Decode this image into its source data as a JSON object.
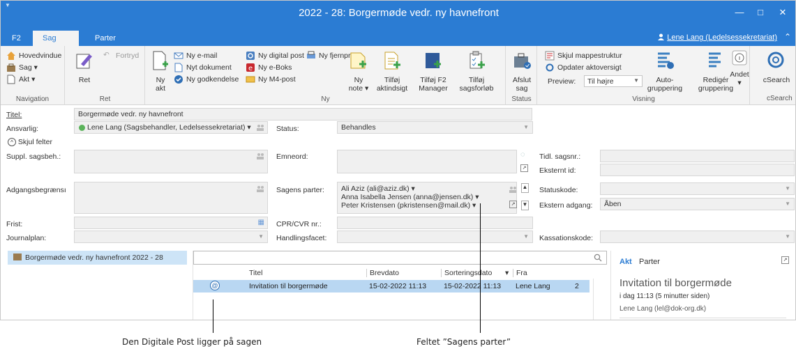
{
  "window": {
    "title": "2022 - 28: Borgermøde vedr. ny havnefront",
    "system_icon": "outlook-icon",
    "controls": [
      "—",
      "□",
      "✕"
    ]
  },
  "ribbon_tabs": [
    "F2",
    "Sag",
    "Parter"
  ],
  "active_tab": "Sag",
  "user": "Lene Lang (Ledelsessekretariat)",
  "groups": {
    "navigation": {
      "label": "Navigation",
      "items": [
        "Hovedvindue",
        "Sag ▾",
        "Akt ▾"
      ]
    },
    "ret": {
      "label": "Ret",
      "ret": "Ret",
      "fortryd": "Fortryd"
    },
    "ny": {
      "label": "Ny",
      "ny_akt_1": "Ny",
      "ny_akt_2": "akt",
      "small": [
        "Ny e-mail",
        "Nyt dokument",
        "Ny godkendelse",
        "Ny digital post",
        "Ny e-Boks",
        "Ny M4-post",
        "Ny fjernprint"
      ],
      "ny_note_1": "Ny",
      "ny_note_2": "note ▾",
      "tilfoej_aktindsigt_1": "Tilføj",
      "tilfoej_aktindsigt_2": "aktindsigt",
      "tilfoej_f2_1": "Tilføj F2",
      "tilfoej_f2_2": "Manager",
      "tilfoej_forloeb_1": "Tilføj",
      "tilfoej_forloeb_2": "sagsforløb"
    },
    "status": {
      "label": "Status",
      "afslut_1": "Afslut",
      "afslut_2": "sag"
    },
    "visning": {
      "label": "Visning",
      "skjul": "Skjul mappestruktur",
      "opdater": "Opdater aktoversigt",
      "preview_label": "Preview:",
      "preview_value": "Til højre",
      "auto_1": "Auto-",
      "auto_2": "gruppering",
      "redig_1": "Redigér",
      "redig_2": "gruppering"
    },
    "andet": {
      "label": "Andet"
    },
    "csearch": {
      "label": "cSearch",
      "btn": "cSearch"
    }
  },
  "form": {
    "titel_label": "Titel:",
    "titel_value": "Borgermøde vedr. ny havnefront",
    "ansvarlig_label": "Ansvarlig:",
    "ansvarlig_value": "Lene Lang (Sagsbehandler, Ledelsessekretariat) ▾",
    "status_label": "Status:",
    "status_value": "Behandles",
    "skjul_felter": "Skjul felter",
    "suppl_label": "Suppl. sagsbeh.:",
    "emneord_label": "Emneord:",
    "tidl_label": "Tidl. sagsnr.:",
    "eksternt_label": "Eksternt id:",
    "adgang_label": "Adgangsbegrænsı",
    "parter_label": "Sagens parter:",
    "parter": [
      "Ali Aziz (ali@aziz.dk) ▾",
      "Anna Isabella Jensen (anna@jensen.dk) ▾",
      "Peter Kristensen (pkristensen@mail.dk) ▾"
    ],
    "statuskode_label": "Statuskode:",
    "ekstern_adgang_label": "Ekstern adgang:",
    "ekstern_adgang_value": "Åben",
    "frist_label": "Frist:",
    "cpr_label": "CPR/CVR nr.:",
    "journalplan_label": "Journalplan:",
    "handlingsfacet_label": "Handlingsfacet:",
    "kassation_label": "Kassationskode:"
  },
  "tree": {
    "item": "Borgermøde vedr. ny havnefront 2022 - 28"
  },
  "list": {
    "columns": [
      "Titel",
      "Brevdato",
      "Sorteringsdato",
      "Fra"
    ],
    "sort_indicator": "▾",
    "rows": [
      {
        "titel": "Invitation til borgermøde",
        "brevdato": "15-02-2022 11:13",
        "sortering": "15-02-2022 11:13",
        "fra": "Lene Lang",
        "extra": "2"
      }
    ]
  },
  "preview": {
    "tabs": [
      "Akt",
      "Parter"
    ],
    "title": "Invitation til borgermøde",
    "subtitle": "i dag 11:13 (5 minutter siden)",
    "from": "Lene Lang (lel@dok-org.dk)"
  },
  "callouts": [
    "Den Digitale Post ligger på sagen",
    "Feltet ”Sagens parter”"
  ]
}
